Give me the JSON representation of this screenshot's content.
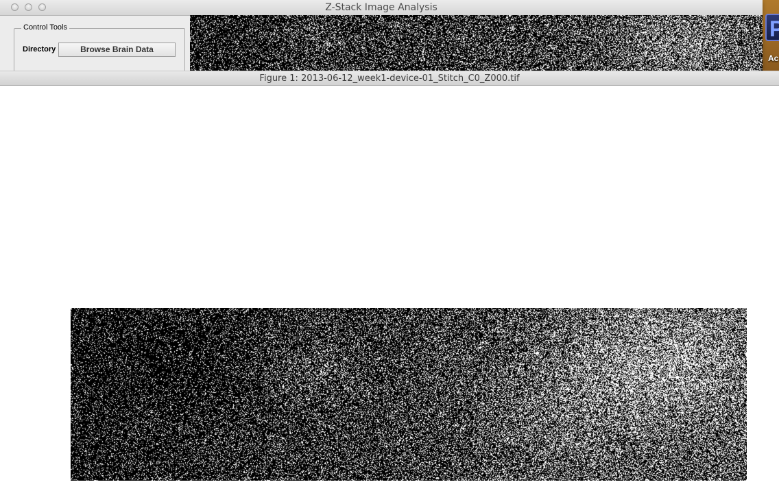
{
  "main_window": {
    "title": "Z-Stack Image Analysis",
    "control_panel": {
      "legend": "Control Tools",
      "directory_label": "Directory",
      "browse_button_label": "Browse Brain Data"
    }
  },
  "figure_window": {
    "title": "Figure 1: 2013-06-12_week1-device-01_Stitch_C0_Z000.tif"
  },
  "dock": {
    "app_letter": "P",
    "app_label": "Ac"
  },
  "colors": {
    "image_background": "#000000",
    "image_speckle": "#ffffff"
  }
}
